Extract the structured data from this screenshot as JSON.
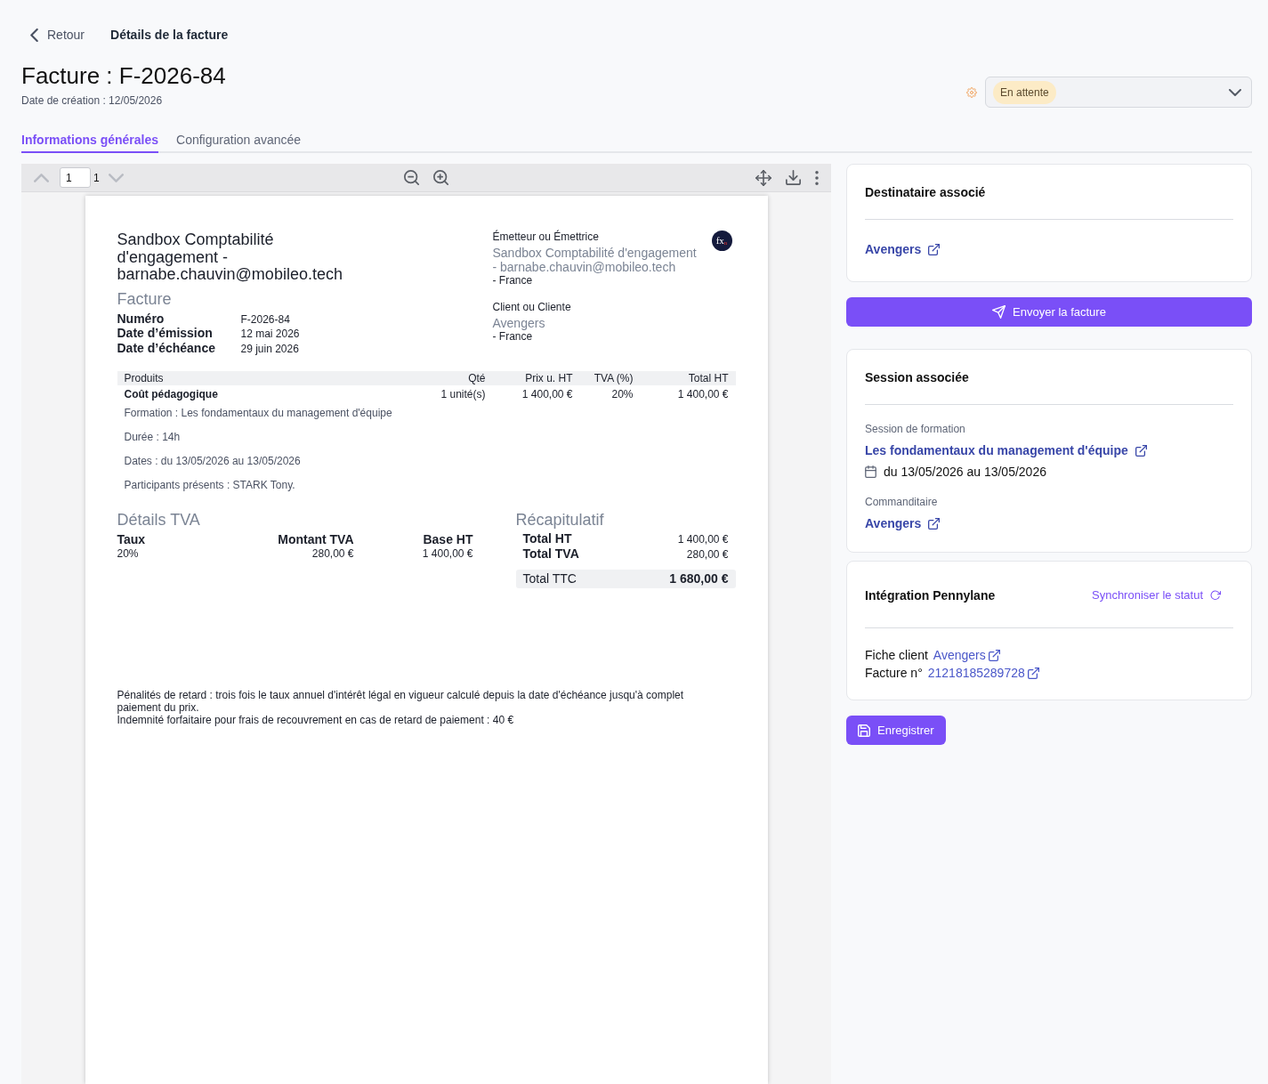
{
  "header": {
    "back_label": "Retour",
    "page_title": "Détails de la facture"
  },
  "invoice": {
    "title": "Facture : F-2026-84",
    "created": "Date de création : 12/05/2026"
  },
  "status": {
    "label": "En attente"
  },
  "tabs": [
    {
      "label": "Informations générales",
      "selected": true
    },
    {
      "label": "Configuration avancée",
      "selected": false
    }
  ],
  "viewer": {
    "page": "1",
    "page_count": "1",
    "previous_disabled": true,
    "next_disabled": true
  },
  "document": {
    "company": "Sandbox Comptabilité d'engagement - barnabe.chauvin@mobileo.tech",
    "title": "Facture",
    "details": [
      {
        "label": "Numéro",
        "value": "F-2026-84"
      },
      {
        "label": "Date d’émission",
        "value": "12 mai 2026"
      },
      {
        "label": "Date d’échéance",
        "value": "29 juin 2026"
      }
    ],
    "logo": "fx$_{n}$",
    "parties": [
      {
        "heading": "Émetteur ou Émettrice",
        "name": "Sandbox Comptabilité d'engagement - barnabe.chauvin@mobileo.tech",
        "country": "- France"
      },
      {
        "heading": "Client ou Cliente",
        "name": "Avengers",
        "country": "- France"
      }
    ],
    "lines_table": {
      "columns": [
        "Produits",
        "Qté",
        "Prix u. HT",
        "TVA (%)",
        "Total HT"
      ],
      "rows": [
        {
          "cells": [
            "Coût pédagogique",
            "1 unité(s)",
            "1 400,00 €",
            "20%",
            "1 400,00 €"
          ],
          "notes": [
            "Formation : Les fondamentaux du management d'équipe",
            "Durée : 14h",
            "Dates : du 13/05/2026 au 13/05/2026",
            "Participants présents : STARK Tony."
          ]
        }
      ]
    },
    "vat": {
      "title": "Détails TVA",
      "columns": [
        "Taux",
        "Montant TVA",
        "Base HT"
      ],
      "rows": [
        [
          "20%",
          "280,00 €",
          "1 400,00 €"
        ]
      ]
    },
    "summary": {
      "title": "Récapitulatif",
      "rows": [
        {
          "kind": "line",
          "label": "Total HT",
          "value": "1 400,00 €"
        },
        {
          "kind": "line",
          "label": "Total TVA",
          "value": "280,00 €"
        },
        {
          "kind": "total",
          "label": "Total TTC",
          "value": "1 680,00 €"
        }
      ]
    },
    "legal": [
      "Pénalités de retard : trois fois le taux annuel d'intérêt légal en vigueur calculé depuis la date d'échéance jusqu'à complet paiement du prix.",
      "Indemnité forfaitaire pour frais de recouvrement en cas de retard de paiement : 40 €"
    ]
  },
  "sidebar": {
    "recipient": {
      "title": "Destinataire associé",
      "link": "Avengers"
    },
    "send_button": "Envoyer la facture",
    "session": {
      "title": "Session associée",
      "session_label": "Session de formation",
      "session_link": "Les fondamentaux du management d'équipe",
      "dates": "du 13/05/2026 au 13/05/2026",
      "sponsor_label": "Commanditaire",
      "sponsor_link": "Avengers"
    },
    "pennylane": {
      "title": "Intégration Pennylane",
      "sync_button": "Synchroniser le statut",
      "rows": [
        {
          "label": "Fiche client",
          "link": "Avengers"
        },
        {
          "label": "Facture n°",
          "link": "21218185289728"
        }
      ]
    },
    "save_button": "Enregistrer"
  }
}
